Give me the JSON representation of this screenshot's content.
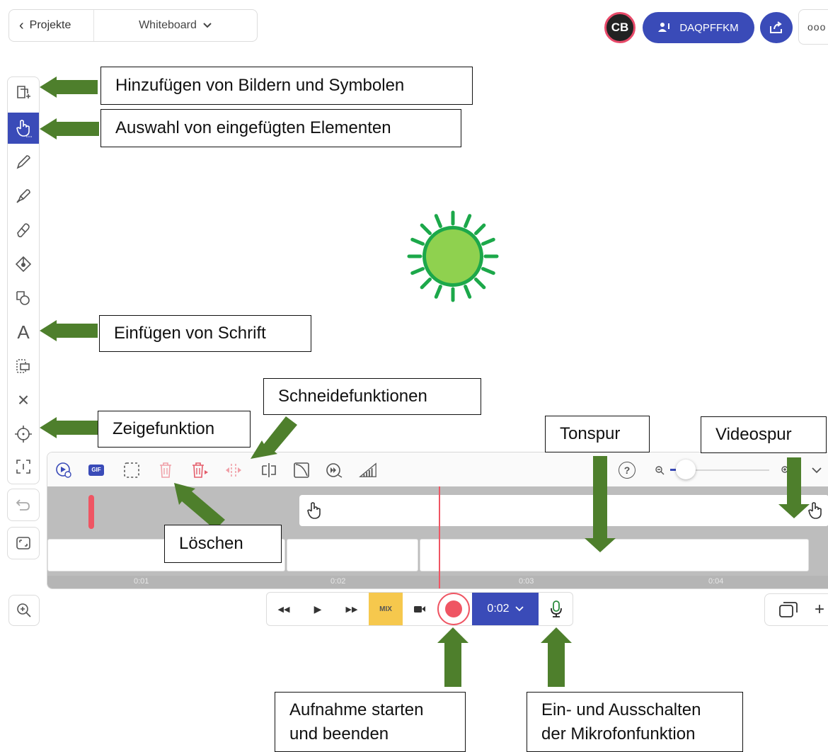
{
  "header": {
    "back_label": "Projekte",
    "title": "Whiteboard",
    "avatar_initials": "CB",
    "room_code": "DAQPFFKM",
    "more_label": "ooo"
  },
  "colors": {
    "accent": "#3a4bb8",
    "record": "#ef5563",
    "mix": "#f6c84d",
    "arrow": "#4e7f2c",
    "sun_fill": "#8fd14f",
    "sun_ring": "#1ca84a"
  },
  "toolbar": {
    "tools": [
      "add-media-icon",
      "select-hand-icon",
      "pencil-icon",
      "highlighter-icon",
      "eraser-icon",
      "fill-bucket-icon",
      "shapes-icon",
      "text-icon",
      "lasso-select-icon",
      "clear-icon",
      "laser-pointer-icon",
      "crop-icon"
    ],
    "active_index": 1,
    "text_tool_glyph": "A",
    "clear_glyph": "×"
  },
  "timeline": {
    "ticks": [
      "0:01",
      "0:02",
      "0:03",
      "0:04"
    ],
    "toolbar_icons": [
      "add-slide-icon",
      "gif-icon",
      "select-range-icon",
      "delete-icon",
      "delete-all-icon",
      "split-icon",
      "trim-icon",
      "fade-icon",
      "speed-icon",
      "volume-icon"
    ],
    "gif_label": "GIF",
    "help_glyph": "?",
    "zoom_level": 0.06
  },
  "transport": {
    "rewind": "◀◀",
    "play": "▶",
    "forward": "▶▶",
    "mix_label": "MIX",
    "time_label": "0:02"
  },
  "layer": {
    "plus": "+"
  },
  "annotations": {
    "add_images": "Hinzufügen von Bildern und Symbolen",
    "select_elements": "Auswahl von eingefügten Elementen",
    "insert_text": "Einfügen von Schrift",
    "cut_functions": "Schneidefunktionen",
    "pointer": "Zeigefunktion",
    "audio_track": "Tonspur",
    "video_track": "Videospur",
    "delete": "Löschen",
    "record_line1": "Aufnahme starten",
    "record_line2": "und beenden",
    "mic_line1": "Ein- und Ausschalten",
    "mic_line2": "der Mikrofonfunktion"
  }
}
